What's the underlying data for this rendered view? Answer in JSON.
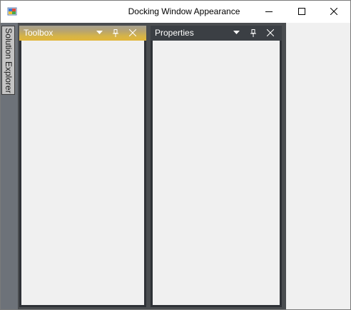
{
  "window": {
    "title": "Docking Window Appearance"
  },
  "autohide": {
    "tab_label": "Solution Explorer"
  },
  "panels": {
    "toolbox": {
      "title": "Toolbox"
    },
    "properties": {
      "title": "Properties"
    }
  },
  "colors": {
    "active_header_accent": "#e2b63a",
    "inactive_header": "#3b3f44",
    "dock_background": "#4a4d50",
    "autohide_strip": "#6d7279"
  },
  "icons": {
    "app": "app-icon",
    "minimize": "minimize-icon",
    "maximize": "maximize-icon",
    "close": "close-icon",
    "dropdown": "dropdown-arrow-icon",
    "pin": "pin-icon",
    "panel_close": "close-icon"
  }
}
